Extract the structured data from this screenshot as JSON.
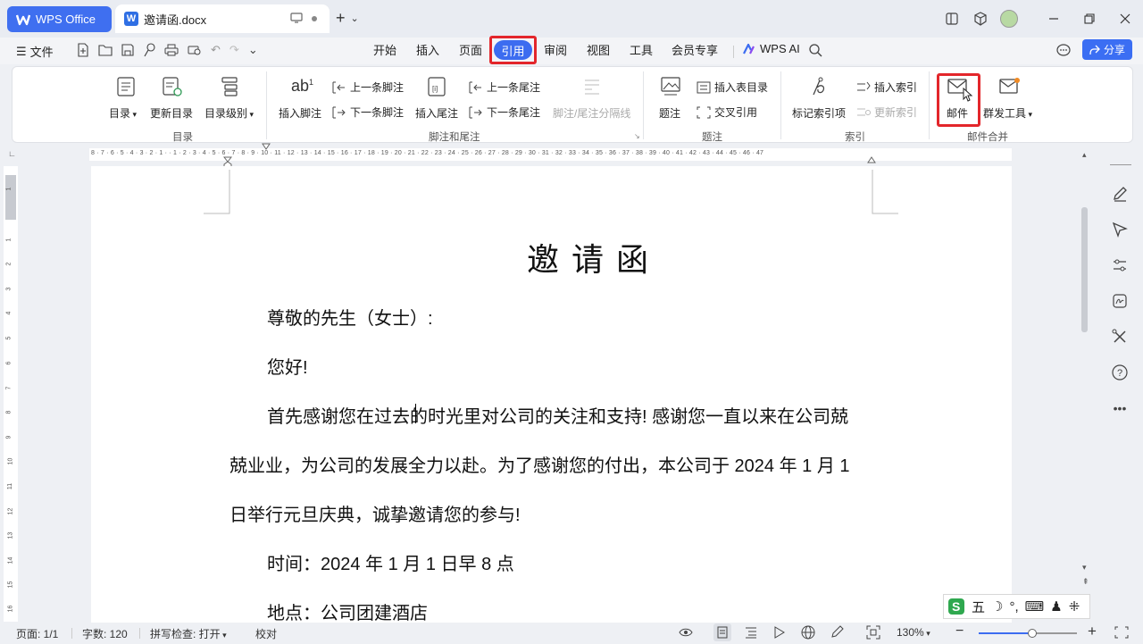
{
  "titlebar": {
    "app_tab": "WPS Office",
    "doc_tab": "邀请函.docx",
    "doc_badge": "W"
  },
  "menubar": {
    "file": "文件",
    "tabs": [
      "开始",
      "插入",
      "页面",
      "引用",
      "审阅",
      "视图",
      "工具",
      "会员专享"
    ],
    "active_tab": "引用",
    "wps_ai": "WPS AI",
    "share": "分享"
  },
  "ribbon": {
    "toc": {
      "group": "目录",
      "toc": "目录",
      "update_toc": "更新目录",
      "toc_level": "目录级别"
    },
    "footnote": {
      "group": "脚注和尾注",
      "insert_footnote": "插入脚注",
      "prev_footnote": "上一条脚注",
      "next_footnote": "下一条脚注",
      "insert_endnote": "插入尾注",
      "prev_endnote": "上一条尾注",
      "next_endnote": "下一条尾注",
      "separator": "脚注/尾注分隔线"
    },
    "caption": {
      "group": "题注",
      "caption": "题注",
      "insert_table_of_figures": "插入表目录",
      "cross_reference": "交叉引用"
    },
    "index": {
      "group": "索引",
      "mark_entry": "标记索引项",
      "insert_index": "插入索引",
      "update_index": "更新索引"
    },
    "mail_merge": {
      "group": "邮件合并",
      "mail": "邮件",
      "bulk_tools": "群发工具"
    }
  },
  "ruler": {
    "ticks": "8 · 7 · 6 · 5 · 4 · 3 · 2 · 1 ·   · 1 · 2 · 3 · 4 · 5 · 6 · 7 · 8 · 9 · 10 · 11 · 12 · 13 · 14 · 15 · 16 · 17 · 18 · 19 · 20 · 21 · 22 · 23 · 24 · 25 · 26 · 27 · 28 · 29 · 30 · 31 · 32 · 33 · 34 · 35 · 36 · 37 · 38 · 39 · 40 · 41 · 42 · 43 · 44 · 45 · 46 · 47",
    "vertical": [
      "1",
      "1",
      "2",
      "3",
      "4",
      "5",
      "6",
      "7",
      "8",
      "9",
      "10",
      "11",
      "12",
      "13",
      "14",
      "15",
      "16"
    ]
  },
  "document": {
    "title": "邀请函",
    "salutation": "尊敬的先生（女士）:",
    "greeting": "您好!",
    "para1_line1": "首先感谢您在过去的时光里对公司的关注和支持! 感谢您一直以来在公司兢",
    "para1_line2": "兢业业，为公司的发展全力以赴。为了感谢您的付出，本公司于 2024 年 1 月 1",
    "para1_line3": "日举行元旦庆典，诚挚邀请您的参与!",
    "time": "时间：2024 年 1 月 1 日早 8 点",
    "place": "地点：公司团建酒店"
  },
  "ime": {
    "mode": "五"
  },
  "status": {
    "page": "页面: 1/1",
    "words": "字数: 120",
    "spellcheck": "拼写检查: 打开",
    "proofread": "校对",
    "zoom": "130%"
  },
  "colors": {
    "accent": "#3c6cf0",
    "highlight_box": "#e3262b"
  }
}
